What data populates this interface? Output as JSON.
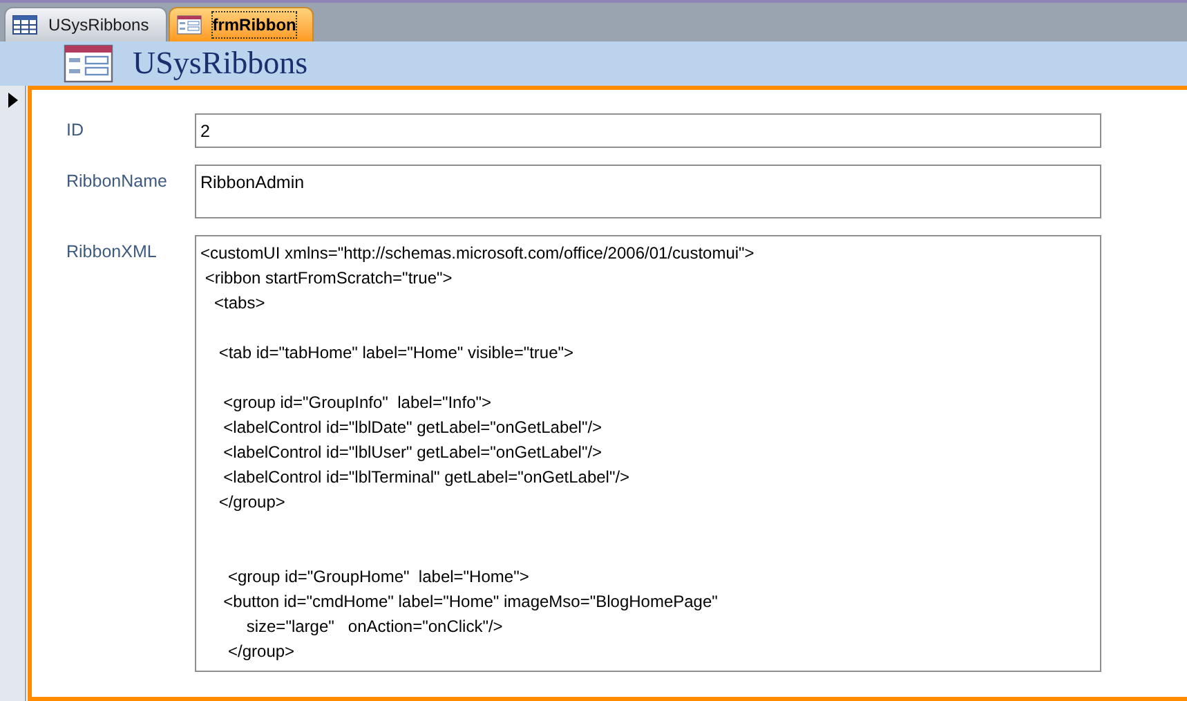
{
  "tabs": [
    {
      "label": "USysRibbons",
      "kind": "table",
      "selected": false
    },
    {
      "label": "frmRibbon",
      "kind": "form",
      "selected": true
    }
  ],
  "form": {
    "title": "USysRibbons"
  },
  "fields": [
    {
      "label": "ID",
      "value": "2",
      "kind": "single"
    },
    {
      "label": "RibbonName",
      "value": "RibbonAdmin",
      "kind": "multi"
    },
    {
      "label": "RibbonXML",
      "value": "<customUI xmlns=\"http://schemas.microsoft.com/office/2006/01/customui\">\n <ribbon startFromScratch=\"true\">\n   <tabs>\n\n    <tab id=\"tabHome\" label=\"Home\" visible=\"true\">\n\n     <group id=\"GroupInfo\"  label=\"Info\">\n     <labelControl id=\"lblDate\" getLabel=\"onGetLabel\"/>\n     <labelControl id=\"lblUser\" getLabel=\"onGetLabel\"/>\n     <labelControl id=\"lblTerminal\" getLabel=\"onGetLabel\"/>\n    </group>\n\n\n      <group id=\"GroupHome\"  label=\"Home\">\n     <button id=\"cmdHome\" label=\"Home\" imageMso=\"BlogHomePage\"\n          size=\"large\"   onAction=\"onClick\"/>\n      </group>",
      "kind": "memo"
    }
  ]
}
